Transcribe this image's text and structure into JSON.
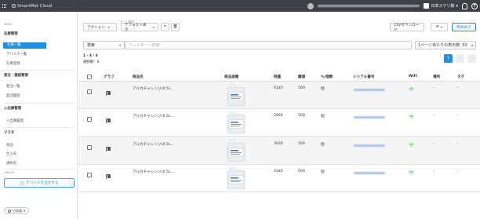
{
  "topbar": {
    "brand": "SmartMat Cloud",
    "tenant": "日本ステリ株",
    "help": "?"
  },
  "sidebar": {
    "menu_head": "MENU",
    "groups": [
      {
        "label": "在庫管理",
        "items": [
          "在庫一覧",
          "デバイス一覧",
          "在庫登録"
        ]
      },
      {
        "label": "発注・連絡管理",
        "items": [
          "発注一覧",
          "発注履歴"
        ]
      },
      {
        "label": "入出庫管理",
        "items": [
          "入出庫履歴"
        ]
      },
      {
        "label": "マスタ",
        "items": [
          "商品",
          "仕入先",
          "通知先"
        ]
      }
    ],
    "order_head": "ORDER",
    "order_button": "デバイスを注文する",
    "language": "日本語"
  },
  "toolbar": {
    "action": "アクション",
    "view_label": "ビュー設定",
    "view_select": "デフォルト表示",
    "csv": "CSVダウンロード",
    "detail": "簡易表示"
  },
  "filter": {
    "search_field": "検索",
    "search_placeholder": "フィルター / 検索",
    "per_page": "1ページあたりの表示数: 50"
  },
  "summary": {
    "range": "1 - 4 / 4",
    "selected": "選択数：0",
    "page": "1"
  },
  "table": {
    "headers": [
      "グラフ",
      "商品名",
      "商品画像",
      "残量",
      "閾値",
      "%/個数",
      "シリアル番号",
      "WiFi",
      "場所",
      "タグ"
    ],
    "rows": [
      {
        "name": "アルカチャレンジ(X 5L...",
        "remaining": "6140",
        "threshold": "500",
        "unit": "個",
        "location": "-",
        "tag": "-"
      },
      {
        "name": "アルカチャレンジ(X 5L...",
        "remaining": "2960",
        "threshold": "500",
        "unit": "個",
        "location": "-",
        "tag": "-"
      },
      {
        "name": "アルカチャレンジ(X 5L...",
        "remaining": "3930",
        "threshold": "500",
        "unit": "個",
        "location": "-",
        "tag": "-"
      },
      {
        "name": "アルカチャレンジ(X 5L...",
        "remaining": "4340",
        "threshold": "500",
        "unit": "個",
        "location": "-",
        "tag": "-"
      }
    ]
  },
  "colors": {
    "accent": "#1e90e6",
    "topbar": "#3d4045",
    "wifi": "#2ecc40"
  }
}
